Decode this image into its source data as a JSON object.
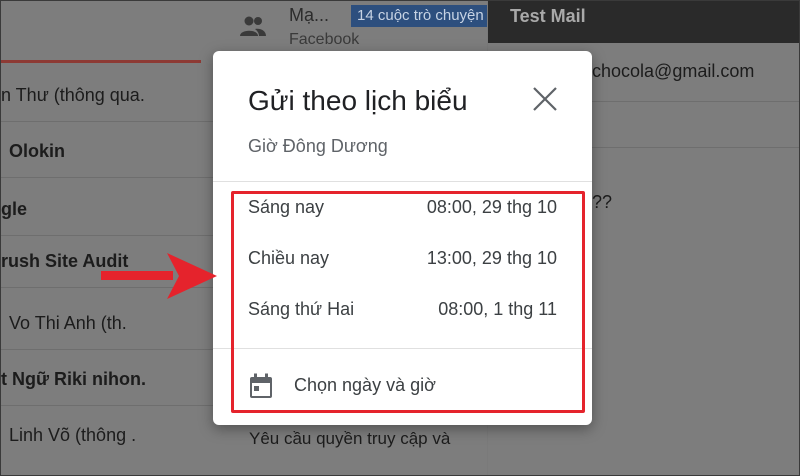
{
  "background": {
    "list_top": {
      "title": "Mạ...",
      "badge": "14 cuộc trò chuyện",
      "subtitle": "Facebook"
    },
    "rows": [
      {
        "text": "n Thư (thông qua.",
        "bold": false
      },
      {
        "text": "Olokin",
        "bold": true
      },
      {
        "text": "gle",
        "bold": true
      },
      {
        "text": "rush Site Audit",
        "bold": true
      },
      {
        "text": "Vo Thi Anh (th.",
        "bold": false
      },
      {
        "text": "t Ngữ Riki nihon.",
        "bold": true
      },
      {
        "text": "Linh Võ (thông .",
        "bold": false
      }
    ],
    "right_panel": {
      "header": "Test Mail",
      "email": "chocola@gmail.com",
      "text": "??"
    },
    "bottom_snippet": "Yêu cầu quyền truy cập và"
  },
  "dialog": {
    "title": "Gửi theo lịch biểu",
    "subtitle": "Giờ Đông Dương",
    "options": [
      {
        "label": "Sáng nay",
        "value": "08:00, 29 thg 10"
      },
      {
        "label": "Chiều nay",
        "value": "13:00, 29 thg 10"
      },
      {
        "label": "Sáng thứ Hai",
        "value": "08:00, 1 thg 11"
      }
    ],
    "pick_label": "Chọn ngày và giờ"
  },
  "colors": {
    "highlight": "#e5232c",
    "overlay": "#7d7d7d"
  }
}
